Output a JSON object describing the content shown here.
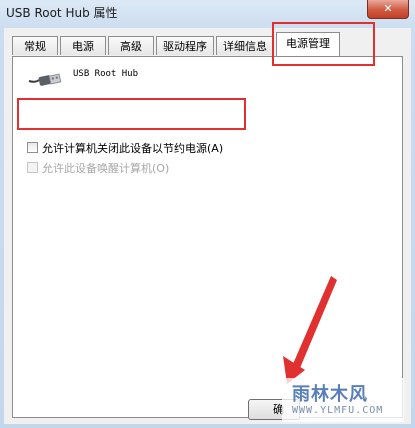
{
  "window": {
    "title": "USB Root Hub 属性",
    "close_label": "✕"
  },
  "tabs": [
    "常规",
    "电源",
    "高级",
    "驱动程序",
    "详细信息",
    "电源管理"
  ],
  "active_tab_index": 5,
  "device": {
    "name": "USB Root Hub",
    "icon": "usb-plug-icon"
  },
  "options": [
    {
      "label": "允许计算机关闭此设备以节约电源(A)",
      "checked": false,
      "enabled": true
    },
    {
      "label": "允许此设备唤醒计算机(O)",
      "checked": false,
      "enabled": false
    }
  ],
  "buttons": {
    "ok_label": "确"
  },
  "watermark": {
    "title": "雨林木风",
    "url": "WWW.YLMFU.COM"
  },
  "colors": {
    "highlight_box": "#e03030"
  }
}
